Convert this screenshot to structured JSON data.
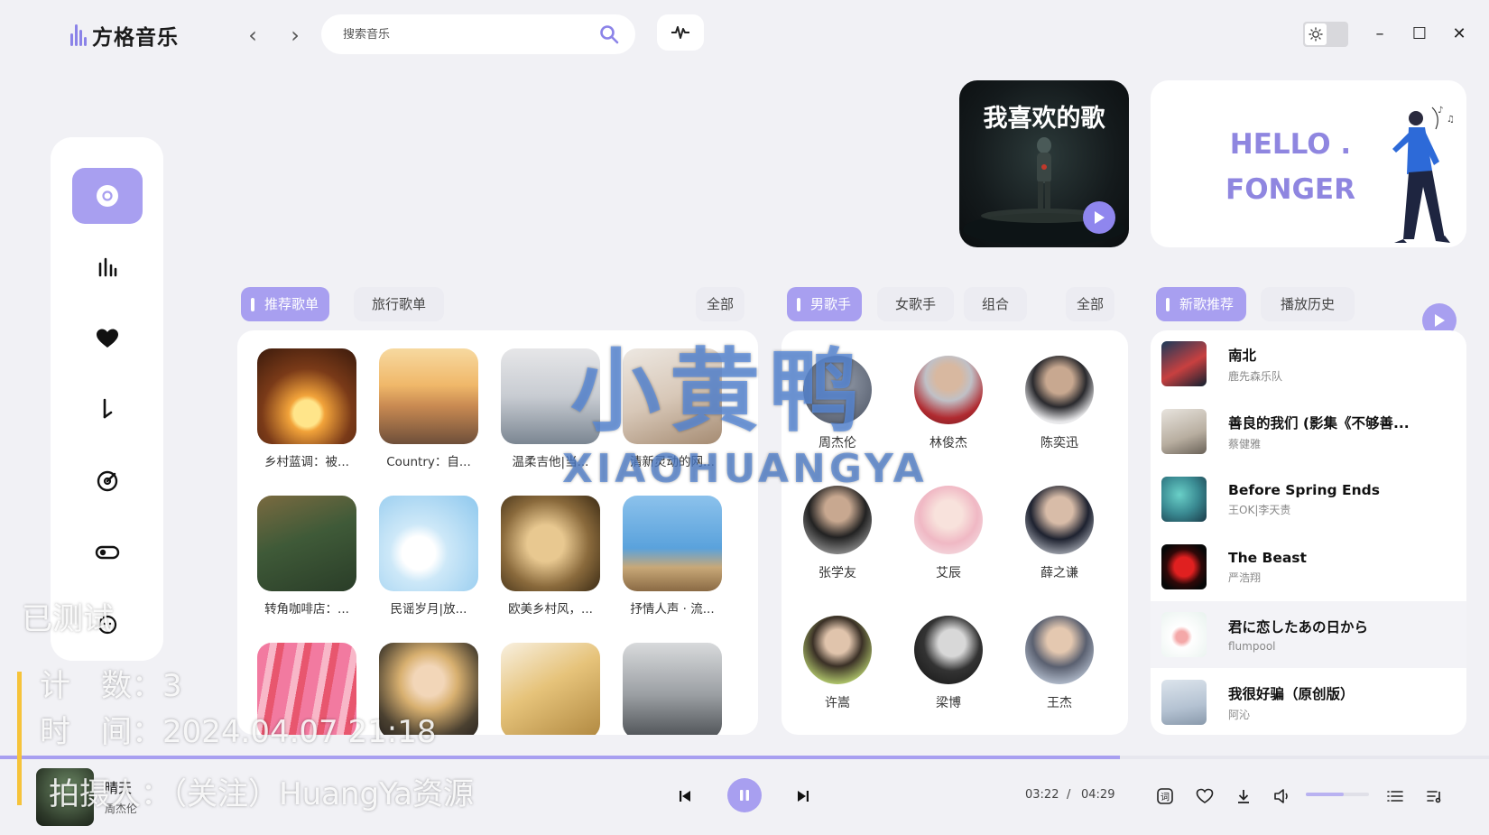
{
  "app": {
    "name": "方格音乐",
    "search_placeholder": "搜索音乐"
  },
  "banners": {
    "favorites_title": "我喜欢的歌",
    "hello_line1": "HELLO .",
    "hello_line2": "FONGER"
  },
  "playlists": {
    "tabs": [
      "推荐歌单",
      "旅行歌单"
    ],
    "all_label": "全部",
    "items": [
      {
        "name": "乡村蓝调：被..."
      },
      {
        "name": "Country：自..."
      },
      {
        "name": "温柔吉他|当..."
      },
      {
        "name": "清新灵动的网..."
      },
      {
        "name": "转角咖啡店：..."
      },
      {
        "name": "民谣岁月|放..."
      },
      {
        "name": "欧美乡村风，..."
      },
      {
        "name": "抒情人声 · 流..."
      },
      {
        "name": ""
      },
      {
        "name": ""
      },
      {
        "name": ""
      },
      {
        "name": ""
      }
    ]
  },
  "singers": {
    "tabs": [
      "男歌手",
      "女歌手",
      "组合"
    ],
    "all_label": "全部",
    "items": [
      {
        "name": "周杰伦"
      },
      {
        "name": "林俊杰"
      },
      {
        "name": "陈奕迅"
      },
      {
        "name": "张学友"
      },
      {
        "name": "艾辰"
      },
      {
        "name": "薛之谦"
      },
      {
        "name": "许嵩"
      },
      {
        "name": "梁博"
      },
      {
        "name": "王杰"
      }
    ]
  },
  "songs": {
    "tabs": [
      "新歌推荐",
      "播放历史"
    ],
    "items": [
      {
        "title": "南北",
        "artist": "鹿先森乐队"
      },
      {
        "title": "善良的我们 (影集《不够善...",
        "artist": "蔡健雅"
      },
      {
        "title": "Before Spring Ends",
        "artist": "王OK|李天责"
      },
      {
        "title": "The Beast",
        "artist": "严浩翔"
      },
      {
        "title": "君に恋したあの日から",
        "artist": "flumpool"
      },
      {
        "title": "我很好骗（原创版）",
        "artist": "阿沁"
      }
    ]
  },
  "player": {
    "song": "晴天",
    "artist": "周杰伦",
    "current_time": "03:22",
    "separator": "/",
    "total_time": "04:29",
    "progress": 0.752,
    "volume": 0.6
  },
  "watermark": {
    "tested": "已测试",
    "count": "计　数：3",
    "time": "时　间：2024.04.07 21:18",
    "photo": "拍摄人：（关注）HuangYa资源",
    "brand_cn": "小黄鸭",
    "brand_en": "XIAOHUANGYA"
  },
  "colors": {
    "accent": "#a89ff0",
    "background": "#f1f1f5",
    "panel": "#ffffff"
  },
  "icons": {
    "sidebar": [
      "disc-icon",
      "chart-icon",
      "heart-icon",
      "music-note-icon",
      "radar-icon",
      "toggle-icon",
      "face-icon"
    ]
  }
}
